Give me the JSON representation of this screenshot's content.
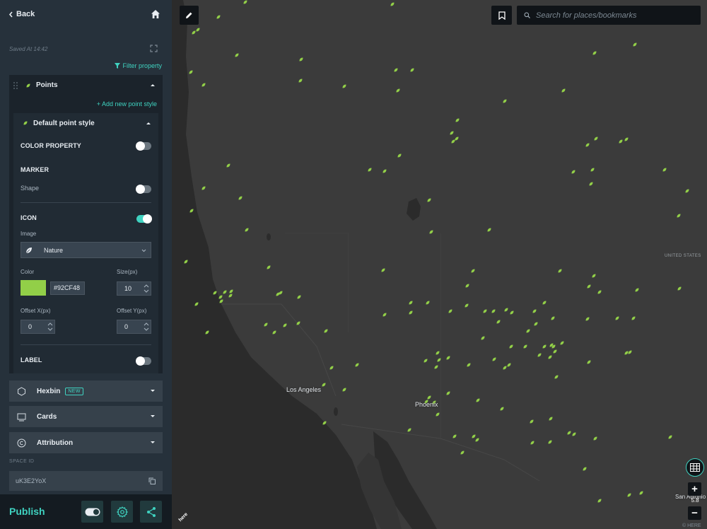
{
  "sidebar": {
    "back_label": "Back",
    "saved_text": "Saved At 14:42",
    "filter_label": "Filter property",
    "points": {
      "title": "Points",
      "add_style_label": "+ Add new point style",
      "default_style": {
        "title": "Default point style",
        "color_property_label": "COLOR PROPERTY",
        "color_property_on": false,
        "marker_label": "MARKER",
        "shape_label": "Shape",
        "shape_on": false,
        "icon_label": "ICON",
        "icon_on": true,
        "image_label": "Image",
        "image_value": "Nature",
        "color_label": "Color",
        "color_value": "#92CF48",
        "size_label": "Size(px)",
        "size_value": "10",
        "offset_x_label": "Offset X(px)",
        "offset_x_value": "0",
        "offset_y_label": "Offset Y(px)",
        "offset_y_value": "0",
        "label_label": "LABEL",
        "label_on": false
      }
    },
    "sections": [
      {
        "label": "Hexbin",
        "icon": "hexagon-icon",
        "badge": "NEW"
      },
      {
        "label": "Cards",
        "icon": "cards-icon"
      },
      {
        "label": "Attribution",
        "icon": "copyright-icon"
      }
    ],
    "space_id_label": "SPACE ID",
    "space_id_value": "uK3E2YoX",
    "publish_label": "Publish"
  },
  "map": {
    "search_placeholder": "Search for places/bookmarks",
    "cities": [
      {
        "name": "Los Angeles"
      },
      {
        "name": "Phoenix"
      },
      {
        "name": "San Antonio"
      }
    ],
    "region_label": "UNITED STATES",
    "zoom_level": "5.8",
    "brand": "here",
    "copyright": "© HERE",
    "point_color": "#92CF48",
    "accent_color": "#3FD2C0"
  }
}
